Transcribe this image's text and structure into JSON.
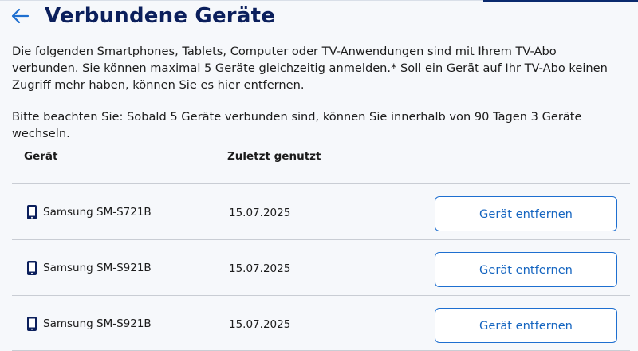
{
  "header": {
    "title": "Verbundene Geräte"
  },
  "intro": "Die folgenden Smartphones, Tablets, Computer oder TV-Anwendungen sind mit Ihrem TV-Abo verbunden. Sie können maximal 5 Geräte gleichzeitig anmelden.* Soll ein Gerät auf Ihr TV-Abo keinen Zugriff mehr haben, können Sie es hier entfernen.",
  "note": "Bitte beachten Sie: Sobald 5 Geräte verbunden sind, können Sie innerhalb von 90 Tagen 3 Geräte wechseln.",
  "table": {
    "col_device": "Gerät",
    "col_last_used": "Zuletzt genutzt",
    "rows": [
      {
        "device": "Samsung SM-S721B",
        "last_used": "15.07.2025",
        "action": "Gerät entfernen"
      },
      {
        "device": "Samsung SM-S921B",
        "last_used": "15.07.2025",
        "action": "Gerät entfernen"
      },
      {
        "device": "Samsung SM-S921B",
        "last_used": "15.07.2025",
        "action": "Gerät entfernen"
      }
    ]
  },
  "icons": {
    "back": "arrow-left-icon",
    "device": "smartphone-icon"
  },
  "colors": {
    "title": "#0b1f5c",
    "accent": "#1e6fd0",
    "button_text": "#1565c0"
  }
}
